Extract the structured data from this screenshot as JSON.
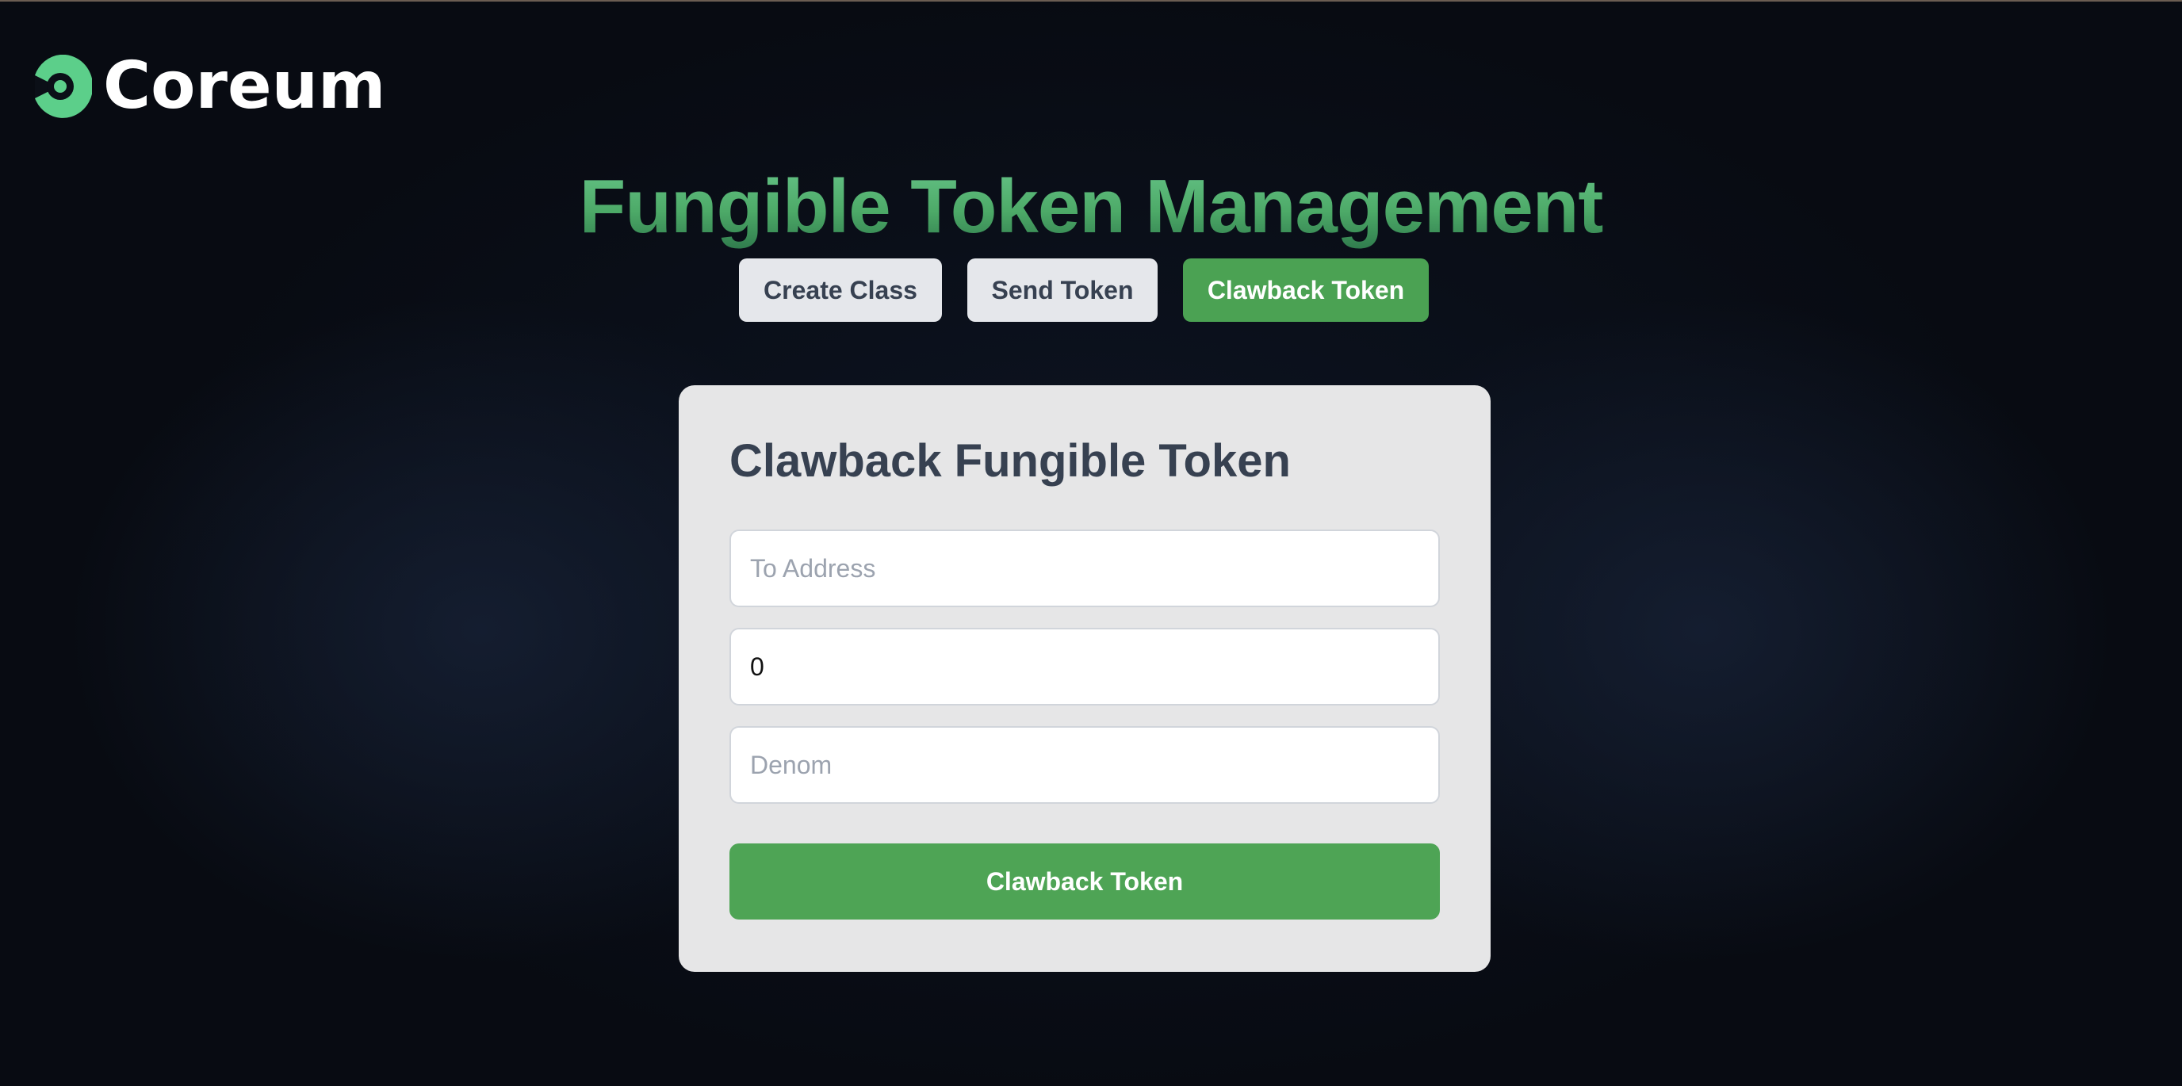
{
  "brand": {
    "name": "Coreum",
    "logo_icon": "coreum-logo-icon",
    "logo_color": "#5ccf8a"
  },
  "header": {
    "title": "Fungible Token Management"
  },
  "tabs": [
    {
      "label": "Create Class",
      "active": false
    },
    {
      "label": "Send Token",
      "active": false
    },
    {
      "label": "Clawback Token",
      "active": true
    }
  ],
  "form": {
    "title": "Clawback Fungible Token",
    "fields": {
      "address": {
        "value": "",
        "placeholder": "To Address"
      },
      "amount": {
        "value": "0",
        "placeholder": ""
      },
      "denom": {
        "value": "",
        "placeholder": "Denom"
      }
    },
    "submit_label": "Clawback Token"
  },
  "colors": {
    "accent_green": "#4ba253",
    "title_green": "#4aae67",
    "background": "#0a0e16",
    "card_background": "#e6e6e7",
    "inactive_tab": "#e5e7eb",
    "text_dark": "#374151"
  }
}
